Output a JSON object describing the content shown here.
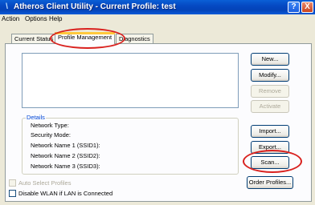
{
  "window": {
    "title": "Atheros Client Utility - Current Profile: test",
    "help_glyph": "?",
    "close_glyph": "X",
    "app_icon_glyph": "\\"
  },
  "menu": [
    "Action",
    "Options",
    "Help"
  ],
  "tabs": [
    "Current Status",
    "Profile Management",
    "Diagnostics"
  ],
  "active_tab": "Profile Management",
  "buttons": {
    "new": "New...",
    "modify": "Modify...",
    "remove": "Remove",
    "activate": "Activate",
    "import": "Import...",
    "export": "Export...",
    "scan": "Scan...",
    "order_profiles": "Order Profiles..."
  },
  "details": {
    "legend": "Details",
    "rows": [
      "Network Type:",
      "Security Mode:",
      "Network Name 1 (SSID1):",
      "Network Name 2 (SSID2):",
      "Network Name 3 (SSID3):"
    ]
  },
  "checkboxes": {
    "auto_select": "Auto Select Profiles",
    "disable_wlan": "Disable WLAN if LAN is Connected"
  },
  "annotation_color": "#d9211e"
}
